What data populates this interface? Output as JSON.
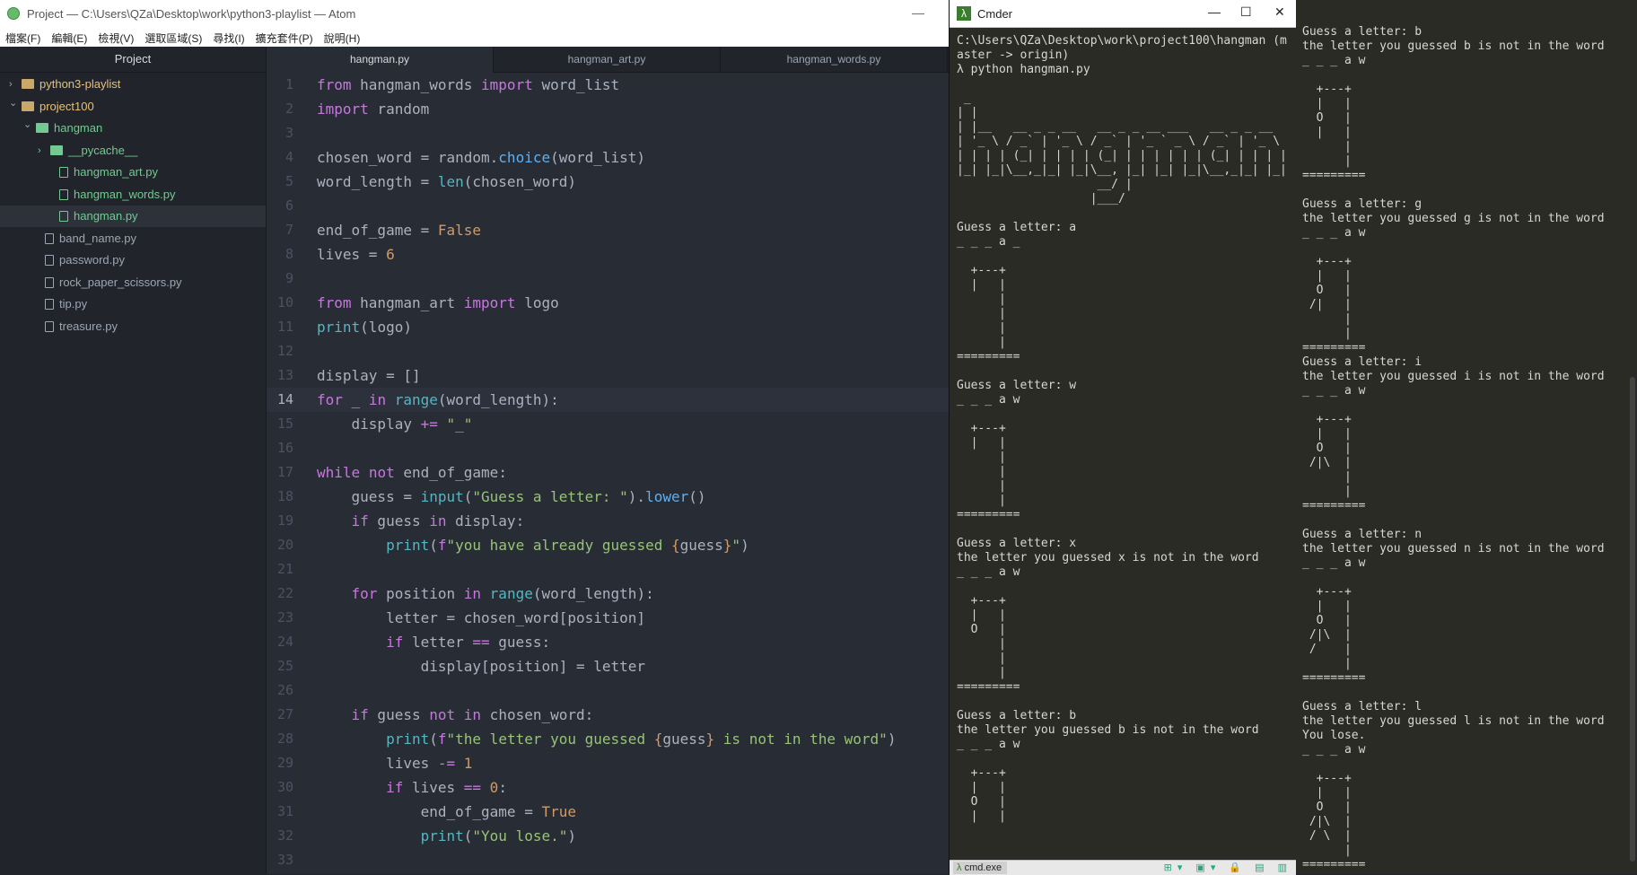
{
  "atom": {
    "title": "Project — C:\\Users\\QZa\\Desktop\\work\\python3-playlist — Atom",
    "minimize_glyph": "—",
    "menu": [
      "檔案(F)",
      "編輯(E)",
      "檢視(V)",
      "選取區域(S)",
      "尋找(I)",
      "擴充套件(P)",
      "說明(H)"
    ],
    "tree": {
      "header": "Project",
      "items": [
        {
          "label": "python3-playlist",
          "kind": "folder",
          "open": false
        },
        {
          "label": "project100",
          "kind": "folder",
          "open": true
        },
        {
          "label": "hangman",
          "kind": "folder-green",
          "open": true
        },
        {
          "label": "__pycache__",
          "kind": "folder-green",
          "open": false
        },
        {
          "label": "hangman_art.py",
          "kind": "file-green"
        },
        {
          "label": "hangman_words.py",
          "kind": "file-green"
        },
        {
          "label": "hangman.py",
          "kind": "file-green",
          "selected": true
        },
        {
          "label": "band_name.py",
          "kind": "file"
        },
        {
          "label": "password.py",
          "kind": "file"
        },
        {
          "label": "rock_paper_scissors.py",
          "kind": "file"
        },
        {
          "label": "tip.py",
          "kind": "file"
        },
        {
          "label": "treasure.py",
          "kind": "file"
        }
      ]
    },
    "tabs": [
      "hangman.py",
      "hangman_art.py",
      "hangman_words.py"
    ],
    "active_tab": 0,
    "cursor_line": 14,
    "code_lines": [
      [
        [
          "kw",
          "from"
        ],
        [
          "t",
          " hangman_words "
        ],
        [
          "kw",
          "import"
        ],
        [
          "t",
          " word_list"
        ]
      ],
      [
        [
          "kw",
          "import"
        ],
        [
          "t",
          " random"
        ]
      ],
      [],
      [
        [
          "t",
          "chosen_word = random."
        ],
        [
          "fn",
          "choice"
        ],
        [
          "t",
          "(word_list)"
        ]
      ],
      [
        [
          "t",
          "word_length = "
        ],
        [
          "bi",
          "len"
        ],
        [
          "t",
          "(chosen_word)"
        ]
      ],
      [],
      [
        [
          "t",
          "end_of_game = "
        ],
        [
          "num",
          "False"
        ]
      ],
      [
        [
          "t",
          "lives = "
        ],
        [
          "num",
          "6"
        ]
      ],
      [],
      [
        [
          "kw",
          "from"
        ],
        [
          "t",
          " hangman_art "
        ],
        [
          "kw",
          "import"
        ],
        [
          "t",
          " logo"
        ]
      ],
      [
        [
          "bi",
          "print"
        ],
        [
          "t",
          "(logo)"
        ]
      ],
      [],
      [
        [
          "t",
          "display = []"
        ]
      ],
      [
        [
          "kw",
          "for"
        ],
        [
          "t",
          " _ "
        ],
        [
          "kw",
          "in"
        ],
        [
          "t",
          " "
        ],
        [
          "bi",
          "range"
        ],
        [
          "t",
          "(word_length):"
        ]
      ],
      [
        [
          "t",
          "    display "
        ],
        [
          "kw",
          "+="
        ],
        [
          "t",
          " "
        ],
        [
          "str",
          "\"_\""
        ]
      ],
      [],
      [
        [
          "kw",
          "while"
        ],
        [
          "t",
          " "
        ],
        [
          "kw",
          "not"
        ],
        [
          "t",
          " end_of_game:"
        ]
      ],
      [
        [
          "t",
          "    guess = "
        ],
        [
          "bi",
          "input"
        ],
        [
          "t",
          "("
        ],
        [
          "str",
          "\"Guess a letter: \""
        ],
        [
          "t",
          ")."
        ],
        [
          "fn",
          "lower"
        ],
        [
          "t",
          "()"
        ]
      ],
      [
        [
          "t",
          "    "
        ],
        [
          "kw",
          "if"
        ],
        [
          "t",
          " guess "
        ],
        [
          "kw",
          "in"
        ],
        [
          "t",
          " display:"
        ]
      ],
      [
        [
          "t",
          "        "
        ],
        [
          "bi",
          "print"
        ],
        [
          "t",
          "("
        ],
        [
          "kw",
          "f"
        ],
        [
          "str",
          "\"you have already guessed "
        ],
        [
          "brace",
          "{"
        ],
        [
          "t",
          "guess"
        ],
        [
          "brace",
          "}"
        ],
        [
          "str",
          "\""
        ],
        [
          "t",
          ")"
        ]
      ],
      [],
      [
        [
          "t",
          "    "
        ],
        [
          "kw",
          "for"
        ],
        [
          "t",
          " position "
        ],
        [
          "kw",
          "in"
        ],
        [
          "t",
          " "
        ],
        [
          "bi",
          "range"
        ],
        [
          "t",
          "(word_length):"
        ]
      ],
      [
        [
          "t",
          "        letter = chosen_word[position]"
        ]
      ],
      [
        [
          "t",
          "        "
        ],
        [
          "kw",
          "if"
        ],
        [
          "t",
          " letter "
        ],
        [
          "kw",
          "=="
        ],
        [
          "t",
          " guess:"
        ]
      ],
      [
        [
          "t",
          "            display[position] = letter"
        ]
      ],
      [],
      [
        [
          "t",
          "    "
        ],
        [
          "kw",
          "if"
        ],
        [
          "t",
          " guess "
        ],
        [
          "kw",
          "not"
        ],
        [
          "t",
          " "
        ],
        [
          "kw",
          "in"
        ],
        [
          "t",
          " chosen_word:"
        ]
      ],
      [
        [
          "t",
          "        "
        ],
        [
          "bi",
          "print"
        ],
        [
          "t",
          "("
        ],
        [
          "kw",
          "f"
        ],
        [
          "str",
          "\"the letter you guessed "
        ],
        [
          "brace",
          "{"
        ],
        [
          "t",
          "guess"
        ],
        [
          "brace",
          "}"
        ],
        [
          "str",
          " is not in the word\""
        ],
        [
          "t",
          ")"
        ]
      ],
      [
        [
          "t",
          "        lives "
        ],
        [
          "kw",
          "-="
        ],
        [
          "t",
          " "
        ],
        [
          "num",
          "1"
        ]
      ],
      [
        [
          "t",
          "        "
        ],
        [
          "kw",
          "if"
        ],
        [
          "t",
          " lives "
        ],
        [
          "kw",
          "=="
        ],
        [
          "t",
          " "
        ],
        [
          "num",
          "0"
        ],
        [
          "t",
          ":"
        ]
      ],
      [
        [
          "t",
          "            end_of_game = "
        ],
        [
          "num",
          "True"
        ]
      ],
      [
        [
          "t",
          "            "
        ],
        [
          "bi",
          "print"
        ],
        [
          "t",
          "("
        ],
        [
          "str",
          "\"You lose.\""
        ],
        [
          "t",
          ")"
        ]
      ],
      []
    ]
  },
  "cmder": {
    "title": "Cmder",
    "window_buttons": [
      "—",
      "☐",
      "✕"
    ],
    "status_tab": "cmd.exe",
    "status_icons": "⊞▾ ▣▾ 🔒 ▤ ▥",
    "terminal": "C:\\Users\\QZa\\Desktop\\work\\project100\\hangman (m\naster -> origin)\nλ python hangman.py\n\n _\n| |\n| |__   __ _ _ __   __ _ _ __ ___   __ _ _ __\n| '_ \\ / _` | '_ \\ / _` | '_ ` _ \\ / _` | '_ \\\n| | | | (_| | | | | (_| | | | | | | (_| | | | |\n|_| |_|\\__,_|_| |_|\\__, |_| |_| |_|\\__,_|_| |_|\n                    __/ |\n                   |___/\n\nGuess a letter: a\n_ _ _ a _\n\n  +---+\n  |   |\n      |\n      |\n      |\n      |\n=========\n\nGuess a letter: w\n_ _ _ a w\n\n  +---+\n  |   |\n      |\n      |\n      |\n      |\n=========\n\nGuess a letter: x\nthe letter you guessed x is not in the word\n_ _ _ a w\n\n  +---+\n  |   |\n  O   |\n      |\n      |\n      |\n=========\n\nGuess a letter: b\nthe letter you guessed b is not in the word\n_ _ _ a w\n\n  +---+\n  |   |\n  O   |\n  |   |"
  },
  "right_terminal": {
    "text": "Guess a letter: b\nthe letter you guessed b is not in the word\n_ _ _ a w\n\n  +---+\n  |   |\n  O   |\n  |   |\n      |\n      |\n=========\n\nGuess a letter: g\nthe letter you guessed g is not in the word\n_ _ _ a w\n\n  +---+\n  |   |\n  O   |\n /|   |\n      |\n      |\n=========\nGuess a letter: i\nthe letter you guessed i is not in the word\n_ _ _ a w\n\n  +---+\n  |   |\n  O   |\n /|\\  |\n      |\n      |\n=========\n\nGuess a letter: n\nthe letter you guessed n is not in the word\n_ _ _ a w\n\n  +---+\n  |   |\n  O   |\n /|\\  |\n /    |\n      |\n=========\n\nGuess a letter: l\nthe letter you guessed l is not in the word\nYou lose.\n_ _ _ a w\n\n  +---+\n  |   |\n  O   |\n /|\\  |\n / \\  |\n      |\n========="
  },
  "colors": {
    "atom_bg": "#282c34",
    "tree_bg": "#21252b",
    "terminal_bg": "#2b2b26",
    "keyword": "#c678dd",
    "function": "#61afef",
    "string": "#98c379",
    "number": "#d19a66"
  }
}
